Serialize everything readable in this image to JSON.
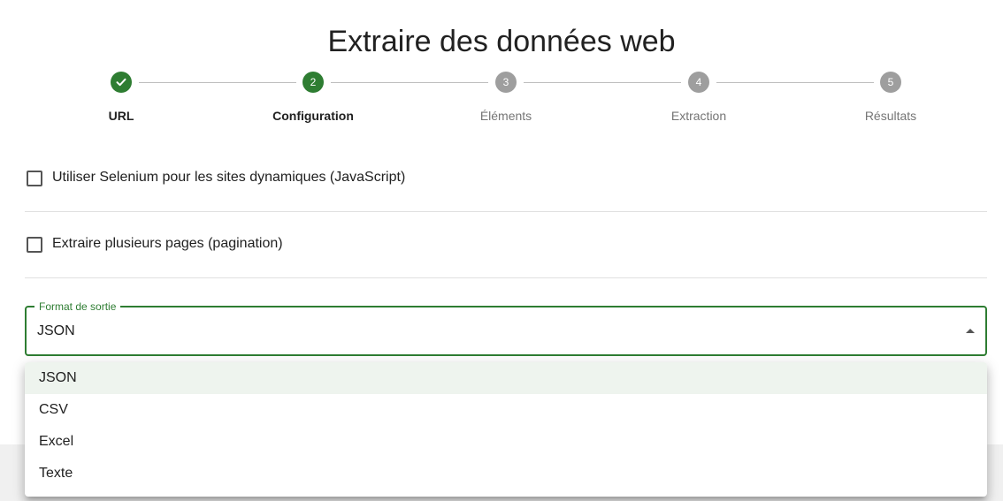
{
  "page": {
    "title": "Extraire des données web"
  },
  "stepper": {
    "steps": [
      {
        "number": "1",
        "label": "URL",
        "status": "done"
      },
      {
        "number": "2",
        "label": "Configuration",
        "status": "active"
      },
      {
        "number": "3",
        "label": "Éléments",
        "status": "pending"
      },
      {
        "number": "4",
        "label": "Extraction",
        "status": "pending"
      },
      {
        "number": "5",
        "label": "Résultats",
        "status": "pending"
      }
    ]
  },
  "options": {
    "selenium": {
      "label": "Utiliser Selenium pour les sites dynamiques (JavaScript)",
      "checked": false
    },
    "pagination": {
      "label": "Extraire plusieurs pages (pagination)",
      "checked": false
    }
  },
  "output_format": {
    "label": "Format de sortie",
    "value": "JSON",
    "options": [
      "JSON",
      "CSV",
      "Excel",
      "Texte"
    ],
    "selected_index": 0
  },
  "colors": {
    "accent": "#2e7d32",
    "inactive_step": "#9e9e9e",
    "selected_option_bg": "#eef4ee"
  },
  "icons": {
    "done_step": "check-icon",
    "select_arrow": "caret-up-icon"
  }
}
